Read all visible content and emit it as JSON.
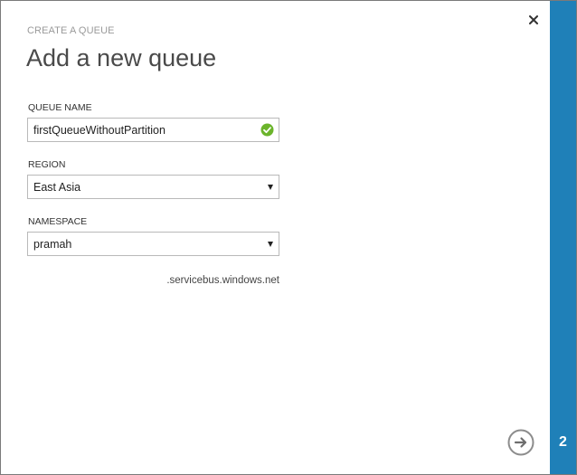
{
  "dialog": {
    "eyebrow": "CREATE A QUEUE",
    "title": "Add a new queue",
    "close_icon": "close-icon",
    "step_number": "2",
    "next_icon": "arrow-right-circle-icon",
    "accent_color": "#1f80b8"
  },
  "form": {
    "queue_name": {
      "label": "QUEUE NAME",
      "value": "firstQueueWithoutPartition",
      "status_icon": "check-circle-icon",
      "status_color": "#6bb42b"
    },
    "region": {
      "label": "REGION",
      "selected": "East Asia"
    },
    "namespace": {
      "label": "NAMESPACE",
      "selected": "pramah",
      "suffix": ".servicebus.windows.net"
    }
  }
}
